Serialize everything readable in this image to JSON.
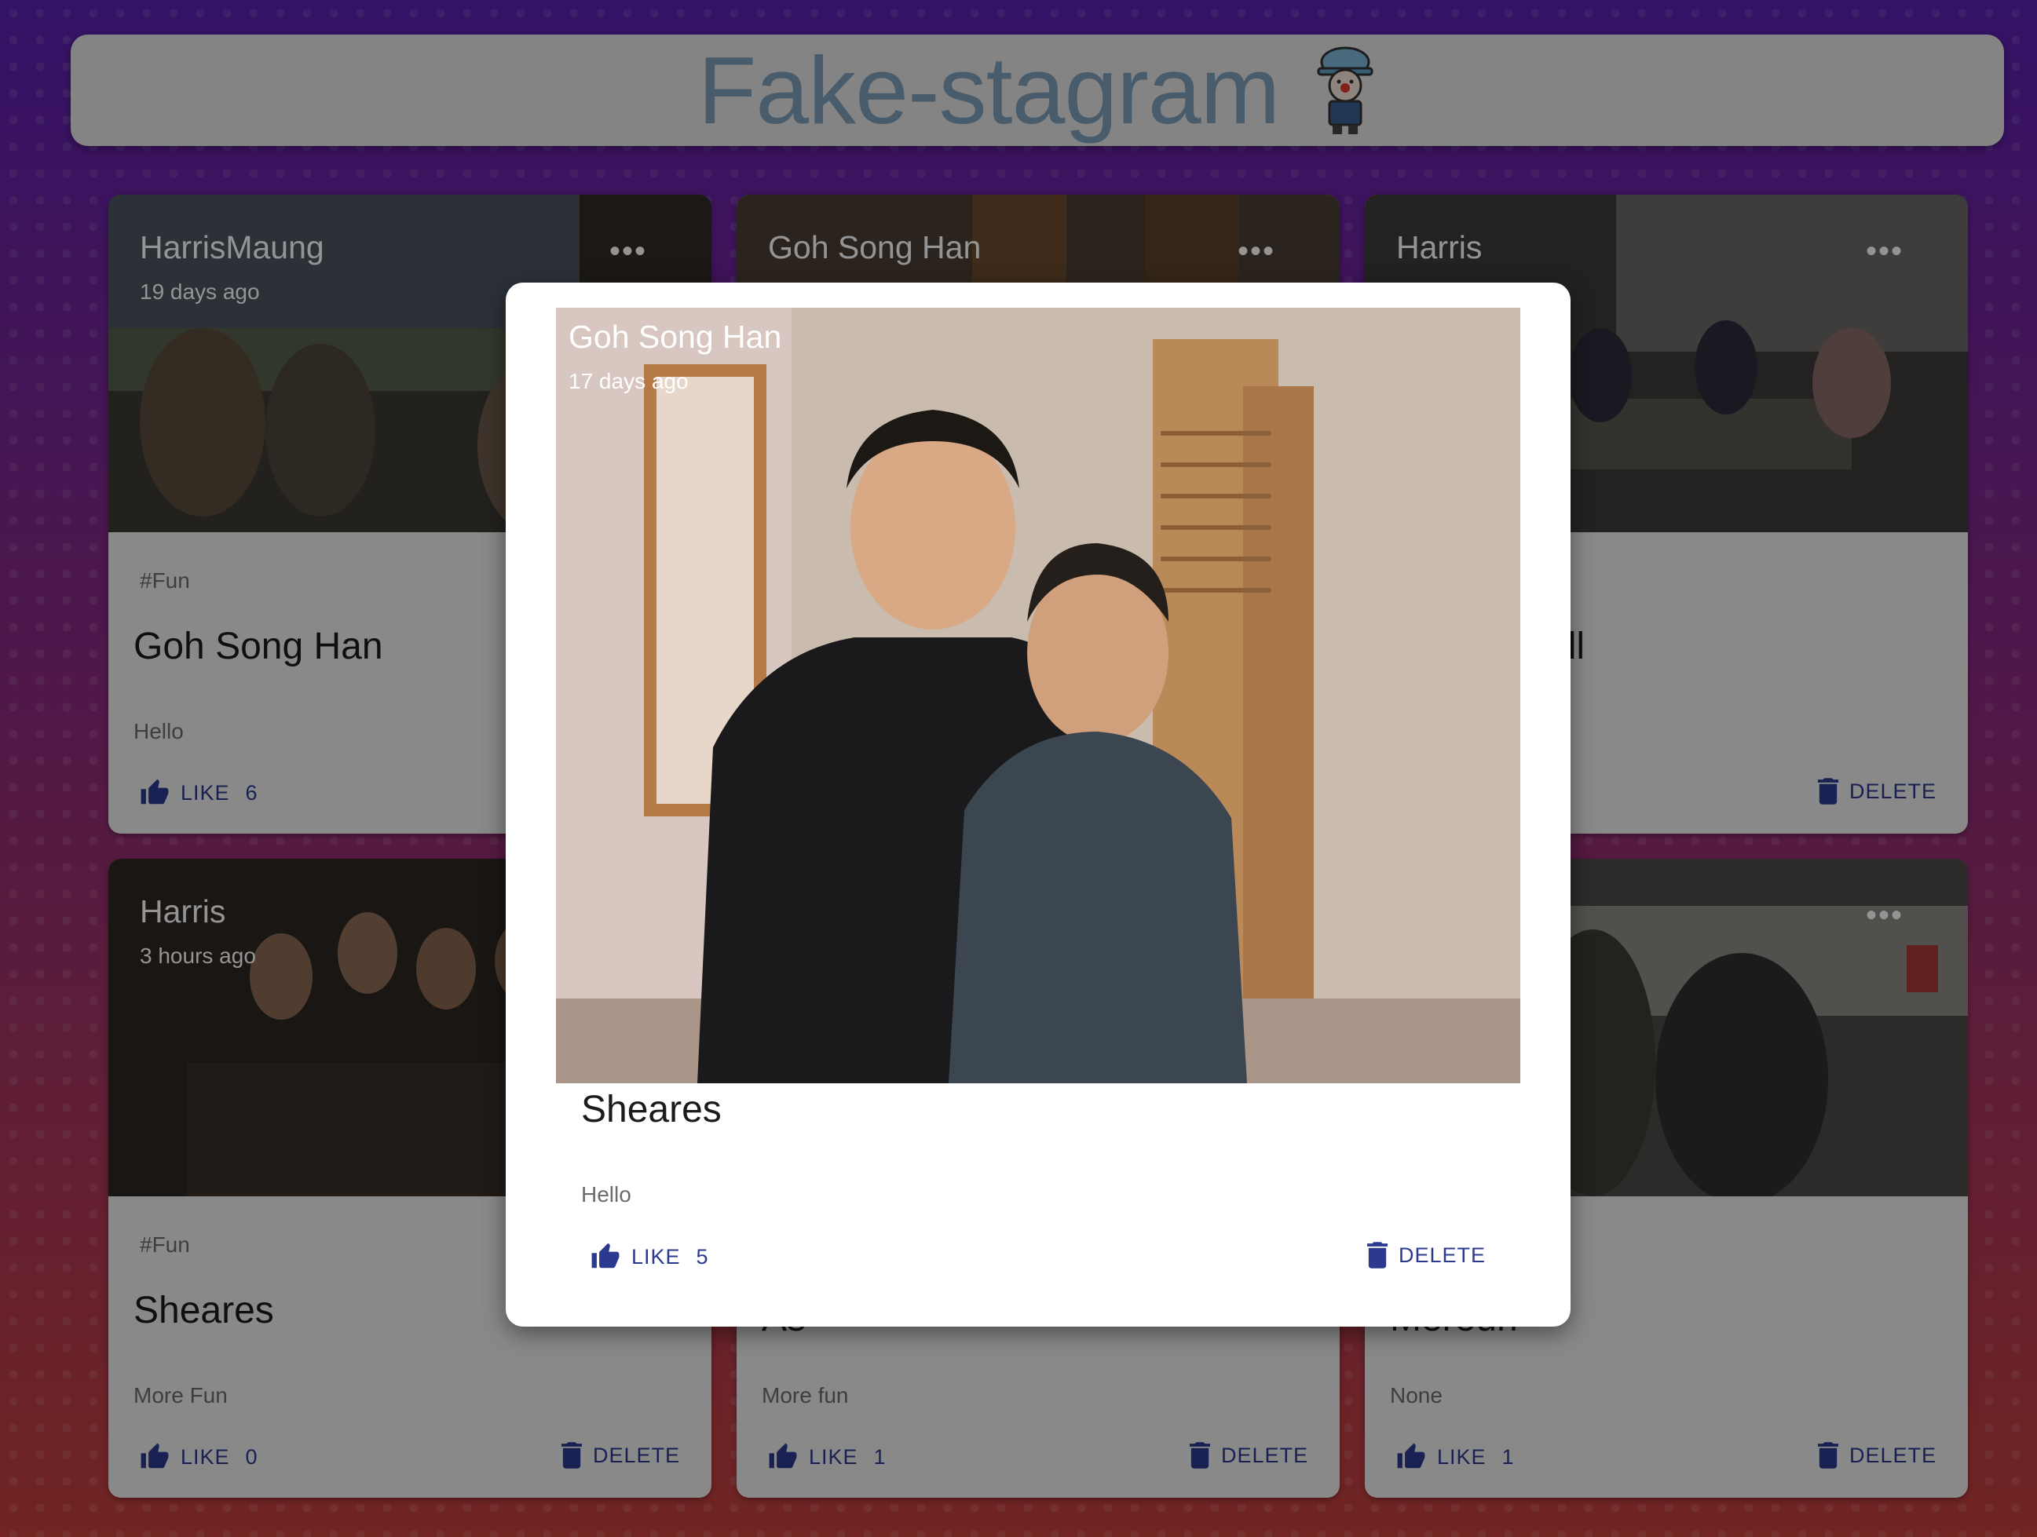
{
  "app": {
    "title": "Fake-stagram",
    "logo_icon": "clown-hardhat-icon"
  },
  "cards": [
    {
      "author": "HarrisMaung",
      "time": "19 days ago",
      "tag": "#Fun",
      "title": "Goh Song Han",
      "description": "Hello",
      "like_label": "LIKE",
      "like_count": "6",
      "delete_label": ""
    },
    {
      "author": "Goh Song Han",
      "time": "",
      "tag": "",
      "title": "",
      "description": "",
      "like_label": "",
      "like_count": "",
      "delete_label": ""
    },
    {
      "author": "Harris",
      "time": "",
      "tag": "",
      "title": "all",
      "description": "",
      "like_label": "",
      "like_count": "",
      "delete_label": "DELETE"
    },
    {
      "author": "Harris",
      "time": "3 hours ago",
      "tag": "#Fun",
      "title": "Sheares",
      "description": "More Fun",
      "like_label": "LIKE",
      "like_count": "0",
      "delete_label": "DELETE"
    },
    {
      "author": "",
      "time": "",
      "tag": "",
      "title": "As",
      "description": "More fun",
      "like_label": "LIKE",
      "like_count": "1",
      "delete_label": "DELETE"
    },
    {
      "author": "",
      "time": "",
      "tag": "",
      "title": "Mereun",
      "description": "None",
      "like_label": "LIKE",
      "like_count": "1",
      "delete_label": "DELETE"
    }
  ],
  "modal": {
    "author": "Goh Song Han",
    "time": "17 days ago",
    "title": "Sheares",
    "description": "Hello",
    "like_label": "LIKE",
    "like_count": "5",
    "delete_label": "DELETE"
  },
  "colors": {
    "accent": "#2b3a8f",
    "header_text": "#7e9fb8"
  }
}
